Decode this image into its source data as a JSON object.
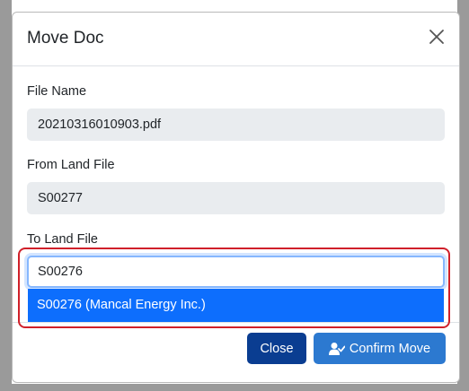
{
  "modal": {
    "title": "Move Doc"
  },
  "fields": {
    "file_name": {
      "label": "File Name",
      "value": "20210316010903.pdf"
    },
    "from_land_file": {
      "label": "From Land File",
      "value": "S00277"
    },
    "to_land_file": {
      "label": "To Land File",
      "value": "S00276"
    }
  },
  "autocomplete": {
    "options": [
      "S00276 (Mancal Energy Inc.)"
    ]
  },
  "footer": {
    "close_label": "Close",
    "confirm_label": "Confirm Move"
  },
  "colors": {
    "primary": "#0d6efd",
    "close_button": "#0a3d91",
    "confirm_button": "#2c79d0",
    "highlight": "#d0202a",
    "readonly_bg": "#e9ecef"
  },
  "icons": {
    "close": "close-icon",
    "confirm": "user-check-icon"
  }
}
